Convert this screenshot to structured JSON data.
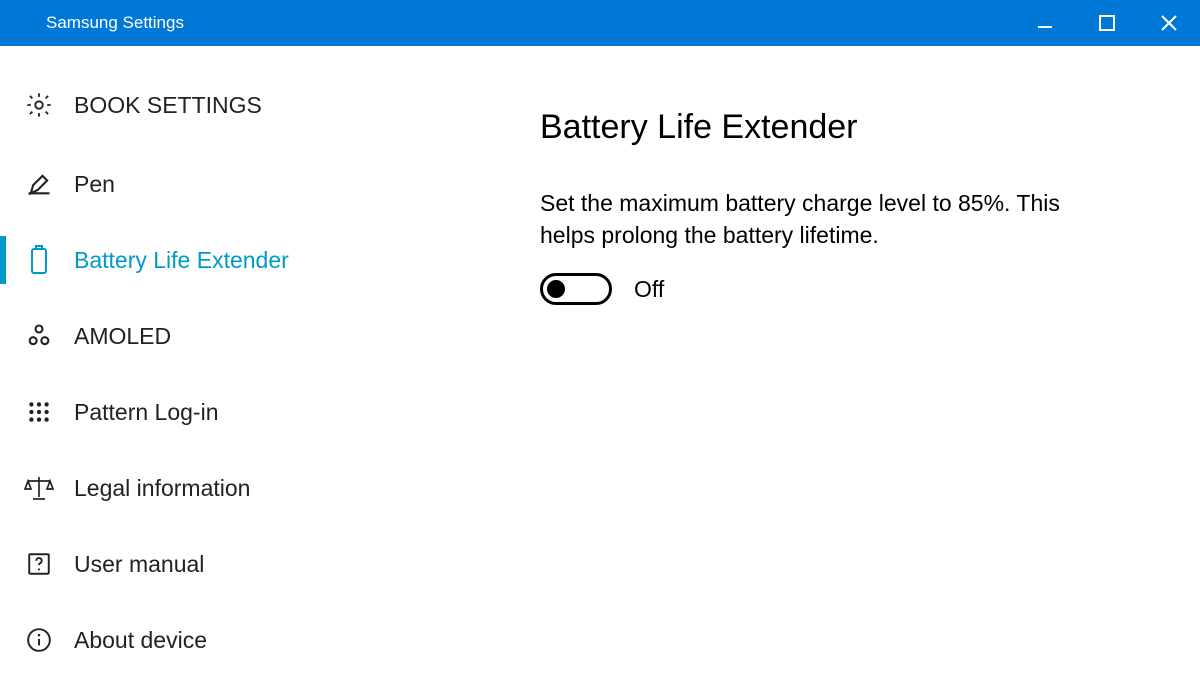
{
  "window": {
    "title": "Samsung Settings"
  },
  "sidebar": {
    "items": [
      {
        "label": "BOOK SETTINGS"
      },
      {
        "label": "Pen"
      },
      {
        "label": "Battery Life Extender"
      },
      {
        "label": "AMOLED"
      },
      {
        "label": "Pattern Log-in"
      },
      {
        "label": "Legal information"
      },
      {
        "label": "User manual"
      },
      {
        "label": "About device"
      }
    ]
  },
  "main": {
    "heading": "Battery Life Extender",
    "description": "Set the maximum battery charge level to 85%. This helps prolong the battery lifetime.",
    "toggle_state": "Off"
  },
  "colors": {
    "accent": "#0078d7",
    "active": "#0099cc"
  }
}
